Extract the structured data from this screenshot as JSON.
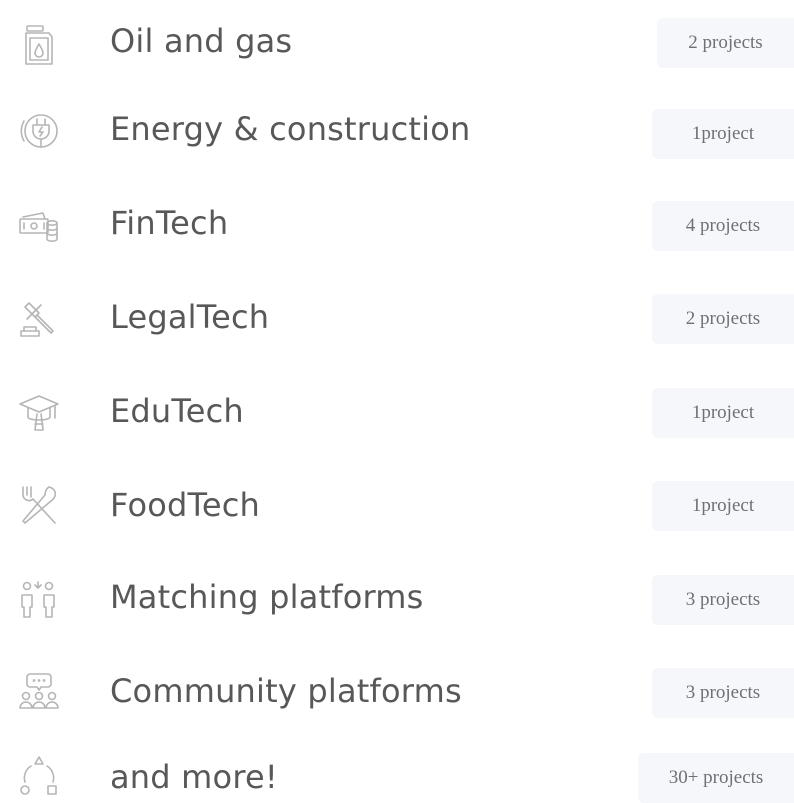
{
  "industries": [
    {
      "label": "Oil and gas",
      "count": "2 projects",
      "icon": "oil-can-icon"
    },
    {
      "label": "Energy & construction",
      "count": "1project",
      "icon": "plug-icon"
    },
    {
      "label": "FinTech",
      "count": "4 projects",
      "icon": "money-icon"
    },
    {
      "label": "LegalTech",
      "count": "2 projects",
      "icon": "gavel-icon"
    },
    {
      "label": "EduTech",
      "count": "1project",
      "icon": "graduation-cap-icon"
    },
    {
      "label": "FoodTech",
      "count": "1project",
      "icon": "utensils-icon"
    },
    {
      "label": "Matching platforms",
      "count": "3 projects",
      "icon": "people-matching-icon"
    },
    {
      "label": "Community platforms",
      "count": "3 projects",
      "icon": "community-icon"
    },
    {
      "label": "and more!",
      "count": "30+ projects",
      "icon": "shapes-icon"
    }
  ],
  "colors": {
    "text": "#585858",
    "icon": "#b5b5b5",
    "badge_bg": "#f6f7fa",
    "badge_text": "#6f6f78"
  }
}
